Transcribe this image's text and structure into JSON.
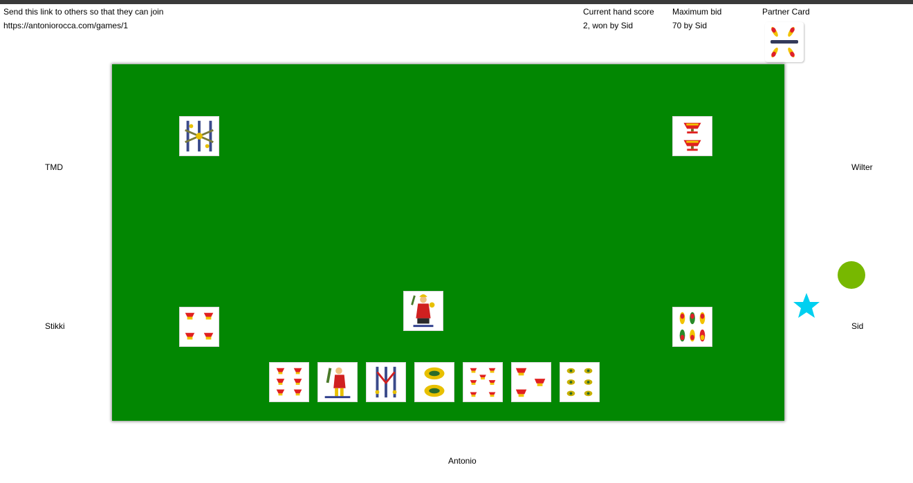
{
  "header": {
    "share_text": "Send this link to others so that they can join",
    "share_link": "https://antoniorocca.com/games/1",
    "score_label": "Current hand score",
    "score_value": "2, won by Sid",
    "bid_label": "Maximum bid",
    "bid_value": "70 by Sid",
    "partner_label": "Partner Card"
  },
  "players": {
    "top_left": "TMD",
    "top_right": "Wilter",
    "bottom_left": "Stikki",
    "bottom_right": "Sid",
    "bottom": "Antonio"
  },
  "partner_card": {
    "suit": "bastoni",
    "rank": "4"
  },
  "played_cards": [
    {
      "player": "TMD",
      "suit": "spade",
      "rank": "6"
    },
    {
      "player": "Wilter",
      "suit": "coppe",
      "rank": "2"
    },
    {
      "player": "Stikki",
      "suit": "coppe",
      "rank": "4"
    },
    {
      "player": "Antonio",
      "suit": "coppe",
      "rank": "8"
    },
    {
      "player": "Sid",
      "suit": "bastoni",
      "rank": "6"
    }
  ],
  "hand": [
    {
      "suit": "coppe",
      "rank": "6"
    },
    {
      "suit": "bastoni",
      "rank": "8"
    },
    {
      "suit": "spade",
      "rank": "3"
    },
    {
      "suit": "denari",
      "rank": "2"
    },
    {
      "suit": "coppe",
      "rank": "7"
    },
    {
      "suit": "coppe",
      "rank": "3"
    },
    {
      "suit": "denari",
      "rank": "6"
    }
  ],
  "indicators": {
    "turn_dot_color": "#77b800",
    "dealer_star_color": "#00d0f0"
  },
  "colors": {
    "table": "#028702"
  }
}
